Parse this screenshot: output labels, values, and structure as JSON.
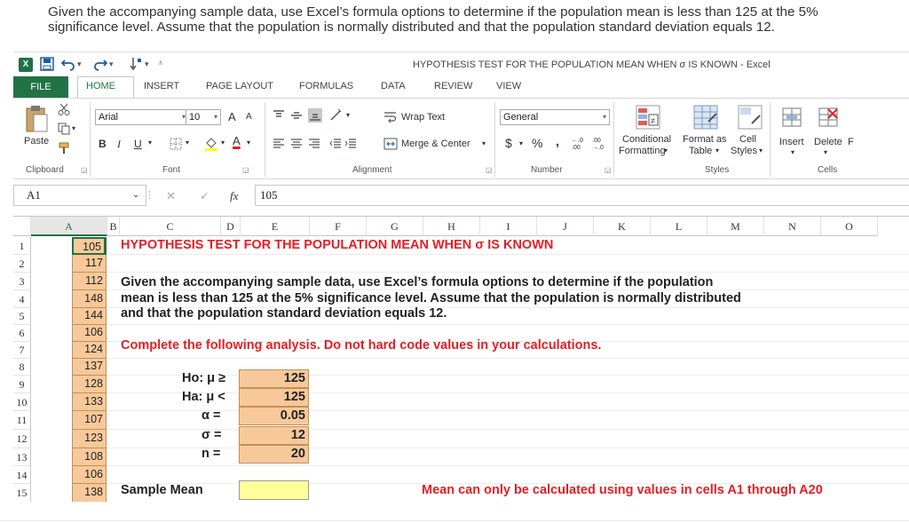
{
  "question": "Given the accompanying sample data, use Excel’s formula options to determine if the population mean is less than 125 at the 5% significance level. Assume that the population is normally distributed and that the population standard deviation equals 12.",
  "window": {
    "title": "HYPOTHESIS TEST FOR THE POPULATION MEAN WHEN σ IS KNOWN - Excel",
    "app_icon": "X"
  },
  "tabs": {
    "file": "FILE",
    "home": "HOME",
    "insert": "INSERT",
    "page_layout": "PAGE LAYOUT",
    "formulas": "FORMULAS",
    "data": "DATA",
    "review": "REVIEW",
    "view": "VIEW"
  },
  "ribbon": {
    "clipboard": {
      "paste": "Paste",
      "label": "Clipboard"
    },
    "font": {
      "name": "Arial",
      "size": "10",
      "bold": "B",
      "italic": "I",
      "underline": "U",
      "grow": "A",
      "shrink": "A",
      "color_letter": "A",
      "label": "Font"
    },
    "alignment": {
      "wrap": "Wrap Text",
      "merge": "Merge & Center",
      "label": "Alignment"
    },
    "number": {
      "format": "General",
      "currency": "$",
      "percent": "%",
      "comma": ",",
      "inc_decimal": "←.0 .00",
      "dec_decimal": ".00 →.0",
      "label": "Number"
    },
    "styles": {
      "conditional_1": "Conditional",
      "conditional_2": "Formatting",
      "format_1": "Format as",
      "format_2": "Table",
      "cell_1": "Cell",
      "cell_2": "Styles",
      "label": "Styles"
    },
    "cells": {
      "insert": "Insert",
      "delete": "Delete",
      "format_cut": "F",
      "label": "Cells"
    }
  },
  "formula_bar": {
    "name_box": "A1",
    "content": "105",
    "fx": "fx",
    "cancel": "✕",
    "enter": "✓"
  },
  "columns": [
    "A",
    "B",
    "C",
    "D",
    "E",
    "F",
    "G",
    "H",
    "I",
    "J",
    "K",
    "L",
    "M",
    "N",
    "O"
  ],
  "rows": [
    "1",
    "2",
    "3",
    "4",
    "5",
    "6",
    "7",
    "8",
    "9",
    "10",
    "11",
    "12",
    "13",
    "14",
    "15"
  ],
  "column_a": [
    "105",
    "117",
    "112",
    "148",
    "144",
    "106",
    "124",
    "137",
    "128",
    "133",
    "107",
    "123",
    "108",
    "106",
    "138"
  ],
  "sheet": {
    "title": "HYPOTHESIS TEST FOR THE POPULATION MEAN WHEN σ IS KNOWN",
    "paragraph": "Given the accompanying sample data, use Excel’s formula options to determine if the population mean is less than 125 at the 5% significance level. Assume that the population is normally distributed and that the population standard deviation equals 12.",
    "instruction": "Complete the following analysis. Do not hard code values in your calculations.",
    "ho_label": "Ho:  μ ≥",
    "ho_value": "125",
    "ha_label": "Ha:  μ <",
    "ha_value": "125",
    "alpha_label": "α =",
    "alpha_value": "0.05",
    "sigma_label": "σ =",
    "sigma_value": "12",
    "n_label": "n =",
    "n_value": "20",
    "sample_mean_label": "Sample Mean",
    "sample_mean_value": "",
    "note": "Mean can only be calculated using values in cells A1 through A20"
  },
  "colors": {
    "excel_green": "#217346",
    "input_orange": "#f7c99a",
    "highlight_yellow": "#ffff99",
    "accent_red": "#e41e25"
  }
}
